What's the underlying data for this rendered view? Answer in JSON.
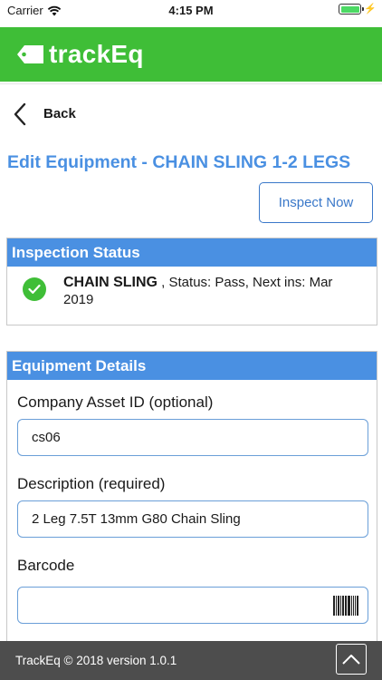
{
  "status_bar": {
    "carrier": "Carrier",
    "time": "4:15 PM",
    "battery_level": 1.0
  },
  "header": {
    "app_title": "trackEq",
    "brand_color": "#3fbe37",
    "logo_icon": "tag-icon"
  },
  "nav": {
    "back_label": "Back",
    "back_icon": "chevron-left-icon"
  },
  "page": {
    "title": "Edit Equipment - CHAIN SLING 1-2 LEGS",
    "inspect_button": "Inspect Now",
    "accent_color": "#4a90e2"
  },
  "inspection_status": {
    "heading": "Inspection Status",
    "item_name": "CHAIN SLING",
    "status_text": ", Status: Pass, Next ins: Mar 2019",
    "status_icon": "check-circle-icon"
  },
  "equipment_details": {
    "heading": "Equipment Details",
    "fields": [
      {
        "label": "Company Asset ID (optional)",
        "value": "cs06"
      },
      {
        "label": "Description (required)",
        "value": "2 Leg 7.5T 13mm G80 Chain Sling"
      },
      {
        "label": "Barcode",
        "value": ""
      }
    ],
    "barcode_icon": "barcode-icon"
  },
  "footer": {
    "copyright": "TrackEq © 2018 version 1.0.1",
    "scroll_top_icon": "chevron-up-icon"
  }
}
